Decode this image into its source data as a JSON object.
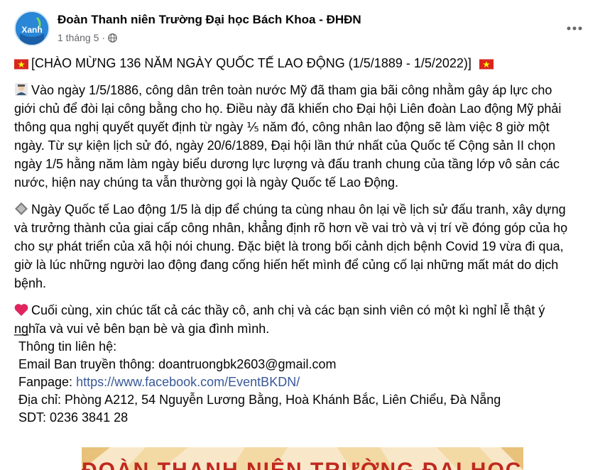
{
  "header": {
    "page_name": "Đoàn Thanh niên Trường Đại học Bách Khoa - ĐHĐN",
    "timestamp": "1 tháng 5",
    "separator": "·",
    "privacy_icon": "globe-icon",
    "more_icon": "more-options-icon",
    "avatar_text": "Xanh"
  },
  "post": {
    "title_line": "[CHÀO MỪNG 136 NĂM NGÀY QUỐC TẾ LAO ĐỘNG (1/5/1889 - 1/5/2022)]",
    "para1": [
      "Vào ngày 1/5/1886, công dân trên toàn nước Mỹ đã tham gia bãi công nhằm gây áp lực cho",
      "giới chủ để đòi lại công bằng cho họ. Điều này đã khiến cho Đại hội Liên đoàn Lao động Mỹ phải",
      "thông qua nghị quyết quyết định từ ngày ⅕  năm đó, công nhân lao động sẽ làm việc 8 giờ một",
      "ngày. Từ sự kiện lịch sử đó, ngày 20/6/1889, Đại hội lần thứ nhất của Quốc tế Cộng sản II chọn",
      "ngày 1/5 hằng năm làm ngày biểu dương lực lượng và đấu tranh chung của tầng lớp vô sản các",
      "nước, hiện nay chúng ta vẫn thường gọi là ngày Quốc tế Lao Động."
    ],
    "para2": [
      "Ngày Quốc tế Lao động 1/5 là dịp để chúng ta cùng nhau ôn lại về lịch sử đấu tranh, xây dựng",
      "và trưởng thành của giai cấp công nhân, khẳng định rõ hơn về vai trò và vị trí về đóng góp của họ",
      "cho sự phát triển của xã hội nói chung. Đặc biệt là trong bối cảnh dịch bệnh Covid 19 vừa đi qua,",
      "giờ là lúc những người lao động đang cống hiến hết mình để củng cố lại những mất mát do dịch",
      "bệnh."
    ],
    "para3": [
      "Cuối cùng, xin chúc tất cả các thầy cô, anh chị và các bạn sinh viên có một kì nghỉ lễ thật ý",
      "nghĩa và vui vẻ bên bạn bè và gia đình mình."
    ],
    "divider": "__",
    "contact_heading": "Thông tin liên hệ:",
    "email_line": "Email Ban truyền thông: doantruongbk2603@gmail.com",
    "fanpage_label": "Fanpage: ",
    "fanpage_url": "https://www.facebook.com/EventBKDN/",
    "address_line": "Địa chỉ: Phòng A212, 54 Nguyễn Lương Bằng, Hoà Khánh Bắc, Liên Chiểu, Đà Nẵng",
    "phone_line": "SDT: 0236 3841 28"
  },
  "banner": {
    "text": "ĐOÀN THANH NIÊN TRƯỜNG ĐẠI HỌC BÁCH KHOA"
  },
  "colors": {
    "text": "#050505",
    "secondary": "#65676b",
    "link": "#385898",
    "flag_red": "#da251d",
    "flag_star": "#ffff00",
    "heart": "#e0245e"
  }
}
